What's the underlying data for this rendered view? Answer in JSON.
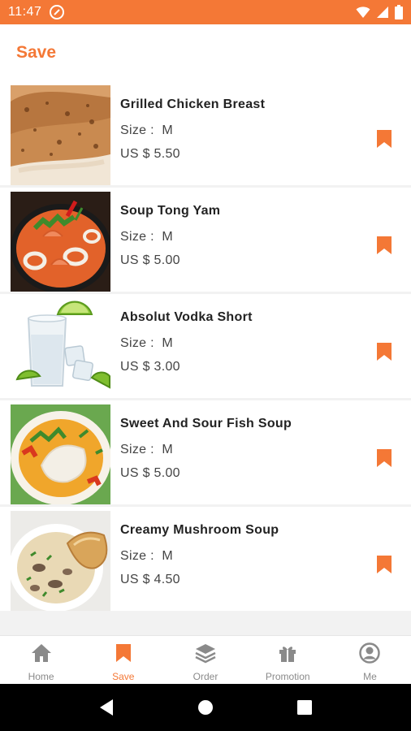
{
  "status_bar": {
    "time": "11:47"
  },
  "header": {
    "title": "Save"
  },
  "items": [
    {
      "name": "Grilled Chicken Breast",
      "size_label": "Size :",
      "size": "M",
      "price": "US $ 5.50"
    },
    {
      "name": "Soup Tong Yam",
      "size_label": "Size :",
      "size": "M",
      "price": "US $ 5.00"
    },
    {
      "name": "Absolut Vodka Short",
      "size_label": "Size :",
      "size": "M",
      "price": "US $ 3.00"
    },
    {
      "name": "Sweet And Sour Fish Soup",
      "size_label": "Size :",
      "size": "M",
      "price": "US $ 5.00"
    },
    {
      "name": "Creamy Mushroom Soup",
      "size_label": "Size :",
      "size": "M",
      "price": "US $ 4.50"
    }
  ],
  "bottom_nav": [
    {
      "label": "Home",
      "icon": "home-icon"
    },
    {
      "label": "Save",
      "icon": "bookmark-icon",
      "active": true
    },
    {
      "label": "Order",
      "icon": "layers-icon"
    },
    {
      "label": "Promotion",
      "icon": "gift-icon"
    },
    {
      "label": "Me",
      "icon": "profile-icon"
    }
  ],
  "colors": {
    "accent": "#f47836",
    "inactive": "#8a8a8a"
  }
}
